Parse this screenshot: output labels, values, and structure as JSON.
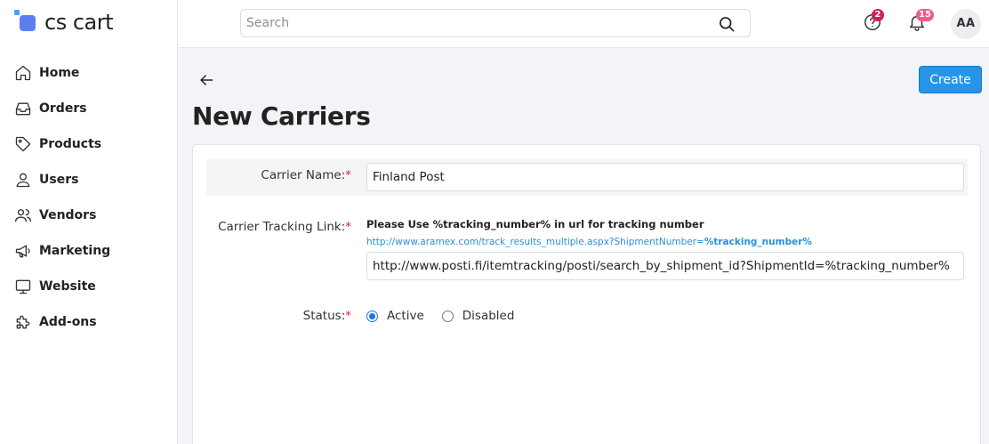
{
  "brand": {
    "name": "cs cart"
  },
  "sidebar": {
    "items": [
      {
        "label": "Home",
        "icon": "home-icon"
      },
      {
        "label": "Orders",
        "icon": "inbox-icon"
      },
      {
        "label": "Products",
        "icon": "tag-icon"
      },
      {
        "label": "Users",
        "icon": "user-icon"
      },
      {
        "label": "Vendors",
        "icon": "users-icon"
      },
      {
        "label": "Marketing",
        "icon": "megaphone-icon"
      },
      {
        "label": "Website",
        "icon": "monitor-icon"
      },
      {
        "label": "Add-ons",
        "icon": "puzzle-icon"
      }
    ]
  },
  "header": {
    "search_placeholder": "Search",
    "help_badge": "2",
    "notifications_badge": "15",
    "avatar_initials": "AA"
  },
  "page": {
    "title": "New Carriers",
    "create_label": "Create"
  },
  "form": {
    "carrier_name": {
      "label": "Carrier Name:",
      "required": "*",
      "value": "Finland Post"
    },
    "tracking_link": {
      "label": "Carrier Tracking Link:",
      "required": "*",
      "hint_title": "Please Use %tracking_number% in url for tracking number",
      "hint_example_prefix": "http://www.aramex.com/track_results_multiple.aspx?ShipmentNumber=",
      "hint_example_token": "%tracking_number%",
      "value": "http://www.posti.fi/itemtracking/posti/search_by_shipment_id?ShipmentId=%tracking_number%"
    },
    "status": {
      "label": "Status:",
      "required": "*",
      "options": [
        "Active",
        "Disabled"
      ],
      "selected": "Active"
    }
  },
  "colors": {
    "accent": "#2695e8",
    "required": "#d21e52",
    "link": "#2b8fd6"
  }
}
